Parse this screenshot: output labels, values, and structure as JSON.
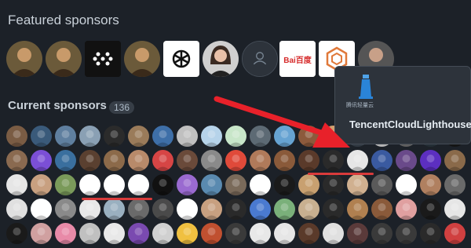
{
  "featured": {
    "title": "Featured sponsors",
    "items": [
      {
        "name": "sponsor-avatar-1",
        "kind": "person",
        "bg": "#6b5a3a"
      },
      {
        "name": "sponsor-avatar-2",
        "kind": "person",
        "bg": "#6b5a3a"
      },
      {
        "name": "sponsor-dots-logo",
        "kind": "dots",
        "bg": "#111111"
      },
      {
        "name": "sponsor-avatar-3",
        "kind": "person",
        "bg": "#6b5a3a"
      },
      {
        "name": "openai-logo",
        "kind": "openai",
        "bg": "#ffffff"
      },
      {
        "name": "sponsor-avatar-woman",
        "kind": "woman",
        "bg": "#cfcfcf"
      },
      {
        "name": "default-user-icon",
        "kind": "ghost",
        "bg": "#2d333b"
      },
      {
        "name": "baidu-logo",
        "kind": "baidu",
        "bg": "#ffffff",
        "text": "Bai百度"
      },
      {
        "name": "hex-logo",
        "kind": "hex",
        "bg": "#ffffff"
      },
      {
        "name": "sponsor-avatar-partial",
        "kind": "person",
        "bg": "#555555"
      }
    ]
  },
  "current": {
    "title": "Current sponsors",
    "count": "136"
  },
  "tooltip": {
    "name": "TencentCloudLighthouse",
    "logo_caption": "腾讯轻量云"
  },
  "grid_colors": [
    [
      "#7a5c44",
      "#3a5a7a",
      "#5f7f9f",
      "#8aa0b4",
      "#2b2b2b",
      "#9a7b5a",
      "#3e6fa8",
      "#c0c0c0",
      "#b6d3ea",
      "#c8e6c9",
      "#5d6a74",
      "#66a3d2",
      "#8c5a3c",
      "#d0a070",
      "#3f4a55",
      "#e8e8e8",
      "#7a7a7a",
      "#2f3b45",
      "#1a1a1a"
    ],
    [
      "#8a6a50",
      "#7b4fd6",
      "#3a6f9e",
      "#5a4030",
      "#8c6a4a",
      "#b88a6a",
      "#d64545",
      "#6a4a3a",
      "#8a8a8a",
      "#e04a3a",
      "#b07a5a",
      "#8a5a3a",
      "#5a3a2a",
      "#2a2a2a",
      "#e6e6e6",
      "#3a5aa0",
      "#6a4a8a",
      "#5c2fc0",
      "#8a6a4a"
    ],
    [
      "#e6e6e6",
      "#c8a080",
      "#7a9a5a",
      "#ffffff",
      "#ffffff",
      "#ffffff",
      "#111111",
      "#9a6ad0",
      "#5a8ab0",
      "#7a6a5a",
      "#ffffff",
      "#1a1a1a",
      "#c8a070",
      "#2a2a2a",
      "#d0b090",
      "#5a5a5a",
      "#ffffff",
      "#b08060",
      "#6a6a6a"
    ],
    [
      "#e0e0e0",
      "#ffffff",
      "#8a8a8a",
      "#e8e8e8",
      "#9ab0c0",
      "#6a6a6a",
      "#4a4a4a",
      "#ffffff",
      "#c8a080",
      "#2a2a2a",
      "#4a7ad0",
      "#7ab07a",
      "#c8b090",
      "#2a2a2a",
      "#b08050",
      "#8a5a3a",
      "#e0a0a0",
      "#1a1a1a",
      "#e6e6e6"
    ],
    [
      "#1a1a1a",
      "#d0a0a0",
      "#e88aa8",
      "#c0c0c0",
      "#e8e8e8",
      "#7a4ab0",
      "#d0d0d0",
      "#f0c040",
      "#c05030",
      "#3a3a3a",
      "#e8e8e8",
      "#e6e6e6",
      "#5a3a2a",
      "#e0e0e0",
      "#5a3a3a",
      "#3a3a3a",
      "#3a3a3a",
      "#2a2a2a",
      "#d04040"
    ]
  ]
}
